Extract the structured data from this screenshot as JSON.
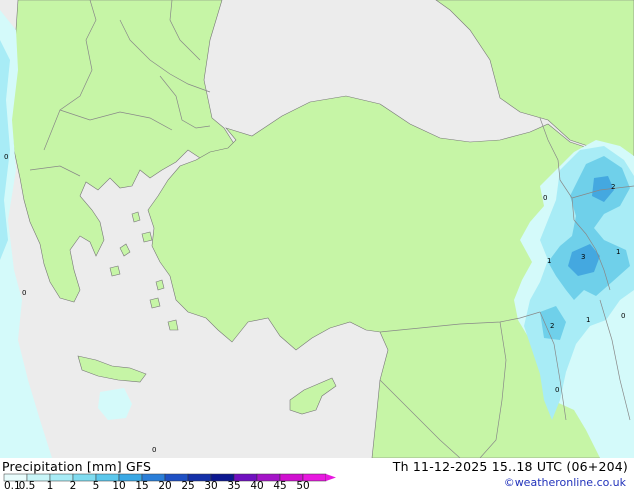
{
  "map": {
    "land_color": "#c6f5a6",
    "sea_color": "#ececec",
    "precip_light": "#d4fafa",
    "precip_mid": "#a8ecf6",
    "precip_heavy": "#6fd0ea",
    "precip_max": "#44a8e0",
    "point_values": [
      "0",
      "0",
      "0",
      "2",
      "1",
      "3",
      "1",
      "2",
      "1",
      "0",
      "0",
      "0"
    ]
  },
  "title": {
    "left": "Precipitation [mm]  GFS",
    "right": "Th 11-12-2025 15..18 UTC (06+204)"
  },
  "credit": "©weatheronline.co.uk",
  "scale": {
    "ticks": [
      "0.1",
      "0.5",
      "1",
      "2",
      "5",
      "10",
      "15",
      "20",
      "25",
      "30",
      "35",
      "40",
      "45",
      "50"
    ],
    "colors": [
      "#e8fcfc",
      "#c8f5f8",
      "#a8ecf6",
      "#80dcf0",
      "#5cc8ec",
      "#3aa8e4",
      "#2a7ed8",
      "#1e50c4",
      "#1430a8",
      "#0c1890",
      "#7010c0",
      "#a414c8",
      "#d010d0",
      "#e818e0"
    ]
  }
}
